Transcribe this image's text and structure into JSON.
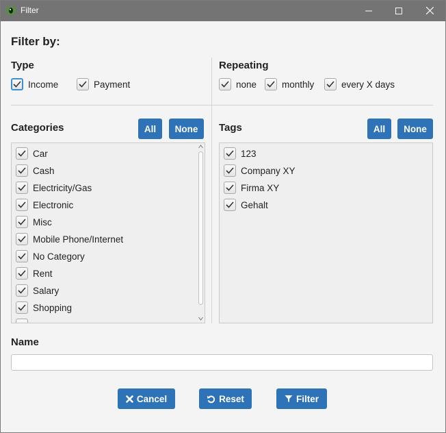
{
  "window": {
    "title": "Filter"
  },
  "heading": "Filter by:",
  "type": {
    "label": "Type",
    "options": [
      {
        "label": "Income",
        "checked": true
      },
      {
        "label": "Payment",
        "checked": true
      }
    ]
  },
  "repeating": {
    "label": "Repeating",
    "options": [
      {
        "label": "none",
        "checked": true
      },
      {
        "label": "monthly",
        "checked": true
      },
      {
        "label": "every X days",
        "checked": true
      }
    ]
  },
  "categories": {
    "label": "Categories",
    "all_label": "All",
    "none_label": "None",
    "items": [
      {
        "label": "Car",
        "checked": true
      },
      {
        "label": "Cash",
        "checked": true
      },
      {
        "label": "Electricity/Gas",
        "checked": true
      },
      {
        "label": "Electronic",
        "checked": true
      },
      {
        "label": "Misc",
        "checked": true
      },
      {
        "label": "Mobile Phone/Internet",
        "checked": true
      },
      {
        "label": "No Category",
        "checked": true
      },
      {
        "label": "Rent",
        "checked": true
      },
      {
        "label": "Salary",
        "checked": true
      },
      {
        "label": "Shopping",
        "checked": true
      }
    ]
  },
  "tags": {
    "label": "Tags",
    "all_label": "All",
    "none_label": "None",
    "items": [
      {
        "label": "123",
        "checked": true
      },
      {
        "label": "Company XY",
        "checked": true
      },
      {
        "label": "Firma XY",
        "checked": true
      },
      {
        "label": "Gehalt",
        "checked": true
      }
    ]
  },
  "name": {
    "label": "Name",
    "value": "",
    "placeholder": ""
  },
  "buttons": {
    "cancel": "Cancel",
    "reset": "Reset",
    "filter": "Filter"
  },
  "colors": {
    "accent": "#2e73b8",
    "titlebar": "#747474",
    "background": "#f4f4f4"
  }
}
